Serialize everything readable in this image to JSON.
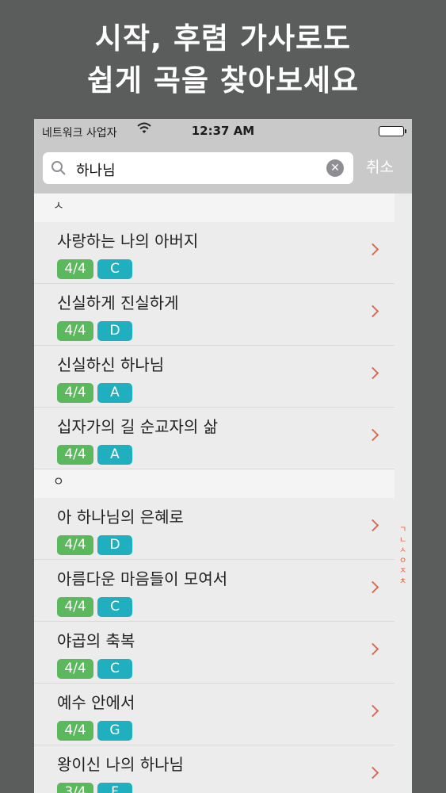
{
  "promo": {
    "line1": "시작, 후렴 가사로도",
    "line2": "쉽게 곡을 찾아보세요"
  },
  "status_bar": {
    "carrier": "네트워크 사업자",
    "time": "12:37 AM",
    "wifi_icon": "wifi-icon",
    "battery_icon": "battery-icon"
  },
  "search": {
    "query": "하나님",
    "cancel_label": "취소",
    "search_icon": "search-icon",
    "clear_icon": "clear-icon"
  },
  "sections": [
    {
      "header": "ㅅ",
      "songs": [
        {
          "title": "사랑하는 나의 아버지",
          "time": "4/4",
          "key": "C"
        },
        {
          "title": "신실하게 진실하게",
          "time": "4/4",
          "key": "D"
        },
        {
          "title": "신실하신 하나님",
          "time": "4/4",
          "key": "A"
        },
        {
          "title": "십자가의 길 순교자의 삶",
          "time": "4/4",
          "key": "A"
        }
      ]
    },
    {
      "header": "ㅇ",
      "songs": [
        {
          "title": "아 하나님의 은혜로",
          "time": "4/4",
          "key": "D"
        },
        {
          "title": "아름다운 마음들이 모여서",
          "time": "4/4",
          "key": "C"
        },
        {
          "title": "야곱의 축복",
          "time": "4/4",
          "key": "C"
        },
        {
          "title": "예수 안에서",
          "time": "4/4",
          "key": "G"
        },
        {
          "title": "왕이신 나의 하나님",
          "time": "3/4",
          "key": "F"
        }
      ]
    }
  ],
  "index_letters": [
    "ㄱ",
    "ㄴ",
    "ㅅ",
    "ㅇ",
    "ㅈ",
    "ㅊ"
  ],
  "colors": {
    "time_badge": "#5cb85c",
    "key_badge": "#1fafbe",
    "chevron": "#e06a4f",
    "index": "#e0553b"
  }
}
